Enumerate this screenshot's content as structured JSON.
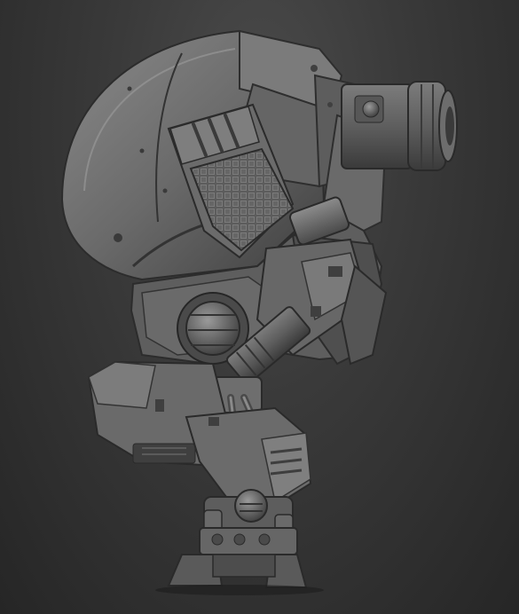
{
  "scene": {
    "subject": "robot-sculpt-render",
    "background_colors": [
      "#4b4b4b",
      "#3a3a3a",
      "#262626"
    ],
    "material_colors": {
      "base": "#6e6e6e",
      "light": "#9a9a9a",
      "mid": "#5a5a5a",
      "dark": "#2f2f2f",
      "shadow": "#1e1e1e"
    }
  }
}
